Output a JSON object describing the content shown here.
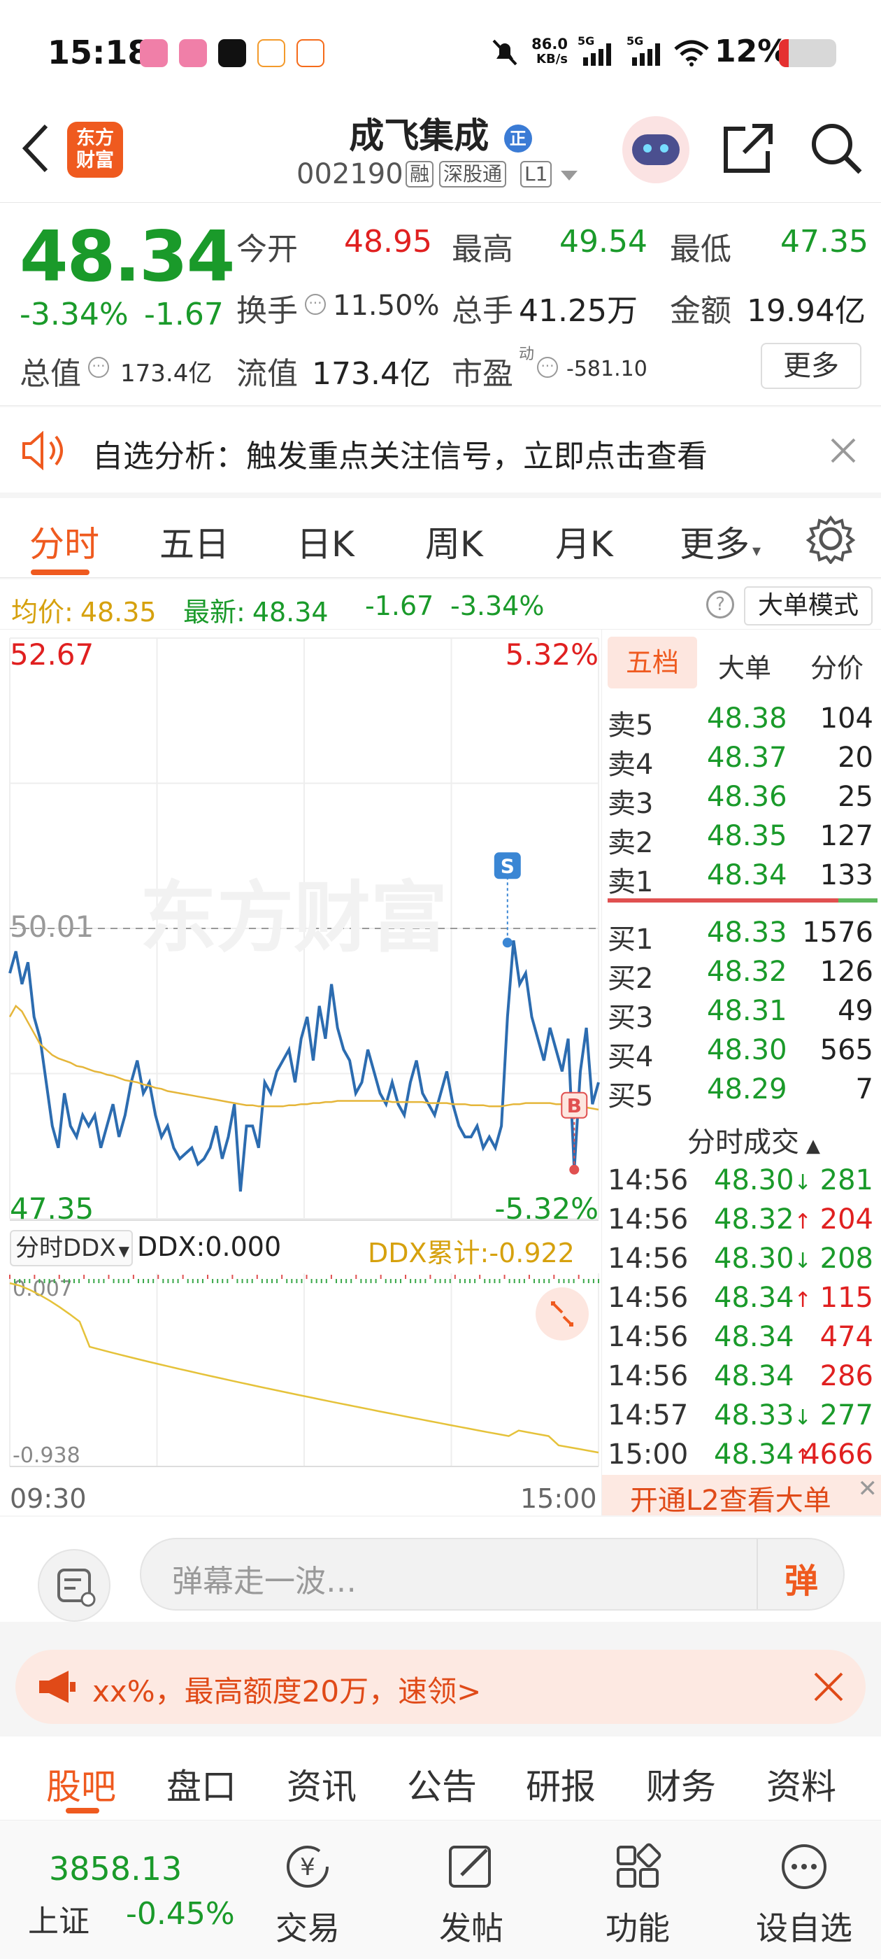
{
  "status": {
    "time": "15:18",
    "net_speed": "86.0",
    "net_unit": "KB/s",
    "signal1": "5G",
    "signal2": "5G",
    "battery": "12%"
  },
  "header": {
    "logo_text": "东方\n财富",
    "title": "成飞集成",
    "title_badge": "正",
    "code": "002190",
    "tag_margin": "融",
    "tag_connect": "深股通",
    "tag_level": "L1"
  },
  "quote": {
    "price": "48.34",
    "change_pct": "-3.34%",
    "change": "-1.67",
    "open_label": "今开",
    "open": "48.95",
    "high_label": "最高",
    "high": "49.54",
    "low_label": "最低",
    "low": "47.35",
    "turnover_label": "换手",
    "turnover": "11.50%",
    "volume_label": "总手",
    "volume": "41.25万",
    "amount_label": "金额",
    "amount": "19.94亿",
    "mcap_label": "总值",
    "mcap": "173.4亿",
    "float_label": "流值",
    "float": "173.4亿",
    "pe_label": "市盈",
    "pe_sup": "动",
    "pe": "-581.10",
    "more": "更多"
  },
  "alert": {
    "text": "自选分析：触发重点关注信号，立即点击查看"
  },
  "tabs": [
    "分时",
    "五日",
    "日K",
    "周K",
    "月K",
    "更多"
  ],
  "info_line": {
    "avg_label": "均价:",
    "avg": "48.35",
    "latest_label": "最新:",
    "latest": "48.34",
    "change": "-1.67",
    "change_pct": "-3.34%",
    "mode_button": "大单模式"
  },
  "chart_data": {
    "type": "line",
    "x_start": "09:30",
    "x_end": "15:00",
    "y_top_label": "52.67",
    "y_bottom_label": "47.35",
    "pct_top_label": "5.32%",
    "pct_bottom_label": "-5.32%",
    "prev_close_label": "50.01",
    "ylim": [
      47.35,
      52.67
    ],
    "watermark": "东方财富",
    "markers": [
      {
        "label": "S",
        "x_index": 82,
        "price": 49.88
      },
      {
        "label": "B",
        "x_index": 93,
        "price": 47.8
      }
    ],
    "series": [
      {
        "name": "price",
        "color": "#2c6cb0",
        "values": [
          49.6,
          49.8,
          49.5,
          49.7,
          49.2,
          49.0,
          48.6,
          48.2,
          48.0,
          48.5,
          48.2,
          48.1,
          48.3,
          48.2,
          48.3,
          48.0,
          48.2,
          48.4,
          48.1,
          48.3,
          48.6,
          48.8,
          48.5,
          48.6,
          48.3,
          48.1,
          48.2,
          48.0,
          47.9,
          47.95,
          48.0,
          47.85,
          47.9,
          48.0,
          48.2,
          47.9,
          48.1,
          48.4,
          47.6,
          48.2,
          48.2,
          48.0,
          48.6,
          48.5,
          48.7,
          48.8,
          48.9,
          48.6,
          49.0,
          49.2,
          48.8,
          49.3,
          49.0,
          49.5,
          49.1,
          48.9,
          48.8,
          48.5,
          48.6,
          48.9,
          48.7,
          48.5,
          48.4,
          48.6,
          48.4,
          48.3,
          48.6,
          48.8,
          48.5,
          48.4,
          48.3,
          48.5,
          48.7,
          48.4,
          48.2,
          48.1,
          48.1,
          48.2,
          48.0,
          48.1,
          48.0,
          48.2,
          49.2,
          49.9,
          49.5,
          49.6,
          49.2,
          49.0,
          48.8,
          49.1,
          48.9,
          48.7,
          49.0,
          47.8,
          48.7,
          49.1,
          48.4,
          48.6
        ]
      },
      {
        "name": "avg",
        "color": "#e5b63a",
        "values": [
          49.2,
          49.3,
          49.25,
          49.15,
          49.05,
          48.95,
          48.9,
          48.85,
          48.82,
          48.8,
          48.78,
          48.75,
          48.74,
          48.72,
          48.7,
          48.69,
          48.67,
          48.66,
          48.64,
          48.62,
          48.61,
          48.6,
          48.58,
          48.57,
          48.55,
          48.54,
          48.52,
          48.51,
          48.5,
          48.49,
          48.48,
          48.47,
          48.46,
          48.45,
          48.44,
          48.43,
          48.42,
          48.41,
          48.4,
          48.39,
          48.39,
          48.38,
          48.38,
          48.38,
          48.38,
          48.38,
          48.39,
          48.39,
          48.4,
          48.4,
          48.41,
          48.41,
          48.42,
          48.42,
          48.43,
          48.43,
          48.43,
          48.43,
          48.43,
          48.43,
          48.43,
          48.43,
          48.43,
          48.42,
          48.42,
          48.42,
          48.42,
          48.42,
          48.42,
          48.41,
          48.41,
          48.41,
          48.41,
          48.4,
          48.4,
          48.4,
          48.39,
          48.39,
          48.39,
          48.38,
          48.38,
          48.38,
          48.39,
          48.4,
          48.4,
          48.41,
          48.41,
          48.41,
          48.41,
          48.41,
          48.4,
          48.4,
          48.4,
          48.39,
          48.38,
          48.37,
          48.36,
          48.35
        ]
      }
    ]
  },
  "ddx": {
    "selector": "分时DDX",
    "value_label": "DDX:0.000",
    "cum_label": "DDX累计:-0.922",
    "top_label": "0.007",
    "bottom_label": "-0.938"
  },
  "depth": {
    "tabs": [
      "五档",
      "大单",
      "分价"
    ],
    "asks": [
      {
        "label": "卖5",
        "price": "48.38",
        "vol": "104"
      },
      {
        "label": "卖4",
        "price": "48.37",
        "vol": "20"
      },
      {
        "label": "卖3",
        "price": "48.36",
        "vol": "25"
      },
      {
        "label": "卖2",
        "price": "48.35",
        "vol": "127"
      },
      {
        "label": "卖1",
        "price": "48.34",
        "vol": "133"
      }
    ],
    "bids": [
      {
        "label": "买1",
        "price": "48.33",
        "vol": "1576"
      },
      {
        "label": "买2",
        "price": "48.32",
        "vol": "126"
      },
      {
        "label": "买3",
        "price": "48.31",
        "vol": "49"
      },
      {
        "label": "买4",
        "price": "48.30",
        "vol": "565"
      },
      {
        "label": "买5",
        "price": "48.29",
        "vol": "7"
      }
    ],
    "ticks_title": "分时成交",
    "ticks": [
      {
        "time": "14:56",
        "price": "48.30",
        "dir": "down",
        "vol": "281"
      },
      {
        "time": "14:56",
        "price": "48.32",
        "dir": "up",
        "vol": "204"
      },
      {
        "time": "14:56",
        "price": "48.30",
        "dir": "down",
        "vol": "208"
      },
      {
        "time": "14:56",
        "price": "48.34",
        "dir": "up",
        "vol": "115"
      },
      {
        "time": "14:56",
        "price": "48.34",
        "dir": "none",
        "vol": "474"
      },
      {
        "time": "14:56",
        "price": "48.34",
        "dir": "none",
        "vol": "286"
      },
      {
        "time": "14:57",
        "price": "48.33",
        "dir": "down",
        "vol": "277"
      },
      {
        "time": "15:00",
        "price": "48.34",
        "dir": "up",
        "vol": "4666"
      }
    ],
    "l2_banner": "开通L2查看大单"
  },
  "comment": {
    "placeholder": "弹幕走一波…",
    "button": "弹"
  },
  "promo": {
    "text": "xx%，最高额度20万，速领>"
  },
  "subtabs": [
    "股吧",
    "盘口",
    "资讯",
    "公告",
    "研报",
    "财务",
    "资料"
  ],
  "bottom": {
    "index_value": "3858.13",
    "index_name": "上证",
    "index_change": "-0.45%",
    "items": [
      "交易",
      "发帖",
      "功能",
      "设自选"
    ]
  }
}
